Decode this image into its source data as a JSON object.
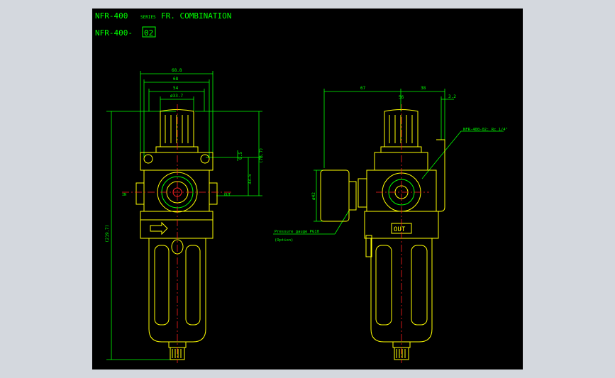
{
  "title": {
    "model": "NFR-400",
    "series": "SERIES",
    "name": "FR. COMBINATION",
    "part_prefix": "NFR-400-",
    "part_code": "02"
  },
  "dimensions": {
    "top_1": "68.8",
    "top_2": "68",
    "top_3": "54",
    "top_4": "ø33.7",
    "height_total": "(219.7)",
    "height_upper": "(78.7)",
    "height_mid": "33.5",
    "height_small": "6.5",
    "side_left": "67",
    "side_mid": "56",
    "side_right": "38",
    "side_small": "3.2",
    "gauge_dia": "ø42"
  },
  "labels": {
    "port": "NFR-400-02: Rc 1/4\"",
    "gauge": "Pressure gauge PG10",
    "option": "(Option)",
    "out": "OUT",
    "in_mark": "IN",
    "out_mark": "OUT"
  },
  "colors": {
    "background": "#000000",
    "frame": "#d4d8de",
    "body": "#ffff00",
    "dimension": "#00ff00",
    "center": "#ff2020",
    "text": "#00ff00"
  }
}
